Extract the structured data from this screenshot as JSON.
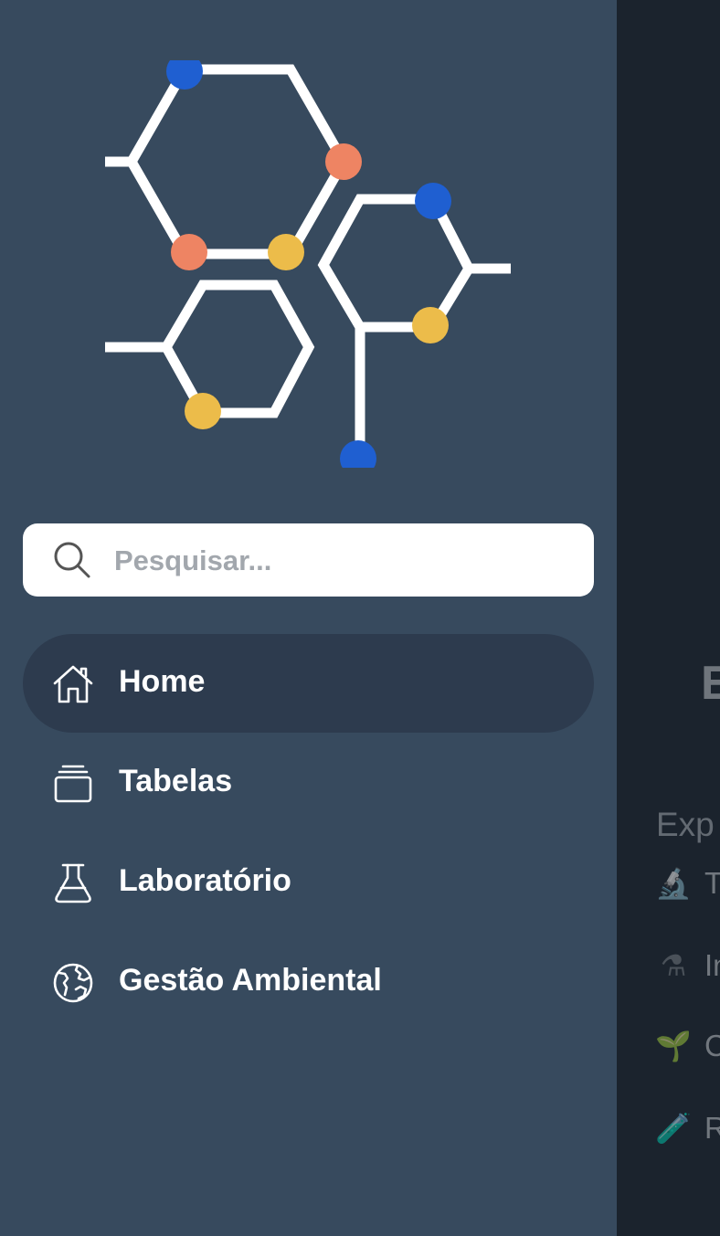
{
  "sidebar": {
    "logo_icon": "molecule-hexagons-icon",
    "search": {
      "placeholder": "Pesquisar...",
      "value": "",
      "icon": "search-icon"
    },
    "nav": [
      {
        "label": "Home",
        "icon": "home-icon",
        "active": true
      },
      {
        "label": "Tabelas",
        "icon": "stack-icon",
        "active": false
      },
      {
        "label": "Laboratório",
        "icon": "flask-icon",
        "active": false
      },
      {
        "label": "Gestão Ambiental",
        "icon": "globe-icon",
        "active": false
      }
    ]
  },
  "main": {
    "heading": "E",
    "subheading": "Exp",
    "items": [
      {
        "icon": "microscope-icon",
        "emoji": "🔬",
        "label": "T"
      },
      {
        "icon": "lab-hood-icon",
        "emoji": "⚗",
        "label": "In"
      },
      {
        "icon": "seedling-icon",
        "emoji": "🌱",
        "label": "C"
      },
      {
        "icon": "test-tube-icon",
        "emoji": "🧪",
        "label": "R"
      }
    ]
  },
  "colors": {
    "sidebar_bg": "#374a5e",
    "nav_active_bg": "#2d3b4e",
    "main_bg": "#1b232d",
    "node_blue": "#1f5fd1",
    "node_orange": "#ee8463",
    "node_yellow": "#ecbc4a"
  }
}
